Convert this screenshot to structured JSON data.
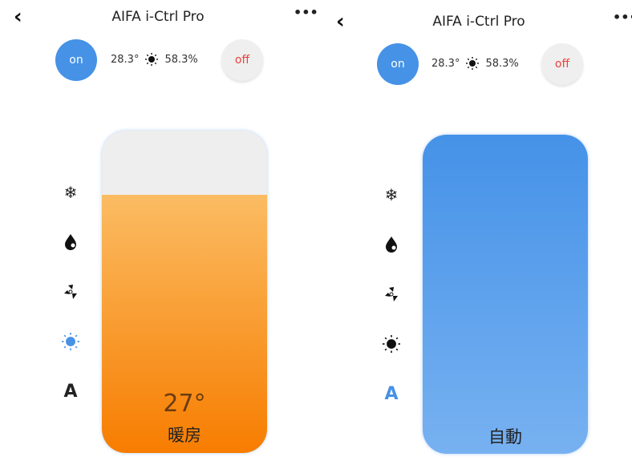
{
  "screens": [
    {
      "title": "AIFA i-Ctrl Pro",
      "on_label": "on",
      "off_label": "off",
      "temperature": "28.3°",
      "humidity": "58.3%",
      "set_temperature": "27°",
      "mode_label": "暖房",
      "active_mode": "heat",
      "fill_percent": 80,
      "fill_color": "#f77d00"
    },
    {
      "title": "AIFA i-Ctrl Pro",
      "on_label": "on",
      "off_label": "off",
      "temperature": "28.3°",
      "humidity": "58.3%",
      "mode_label": "自動",
      "active_mode": "auto",
      "fill_color": "#4592e8"
    }
  ],
  "modes": [
    "cool",
    "dry",
    "fan",
    "heat",
    "auto"
  ],
  "icons": {
    "cool": "snowflake-icon",
    "dry": "drop-icon",
    "fan": "fan-icon",
    "heat": "sun-icon",
    "auto": "auto-a-icon"
  },
  "colors": {
    "accent": "#4592e6",
    "off_text": "#e8443a",
    "active_icon": "#4592e6"
  }
}
